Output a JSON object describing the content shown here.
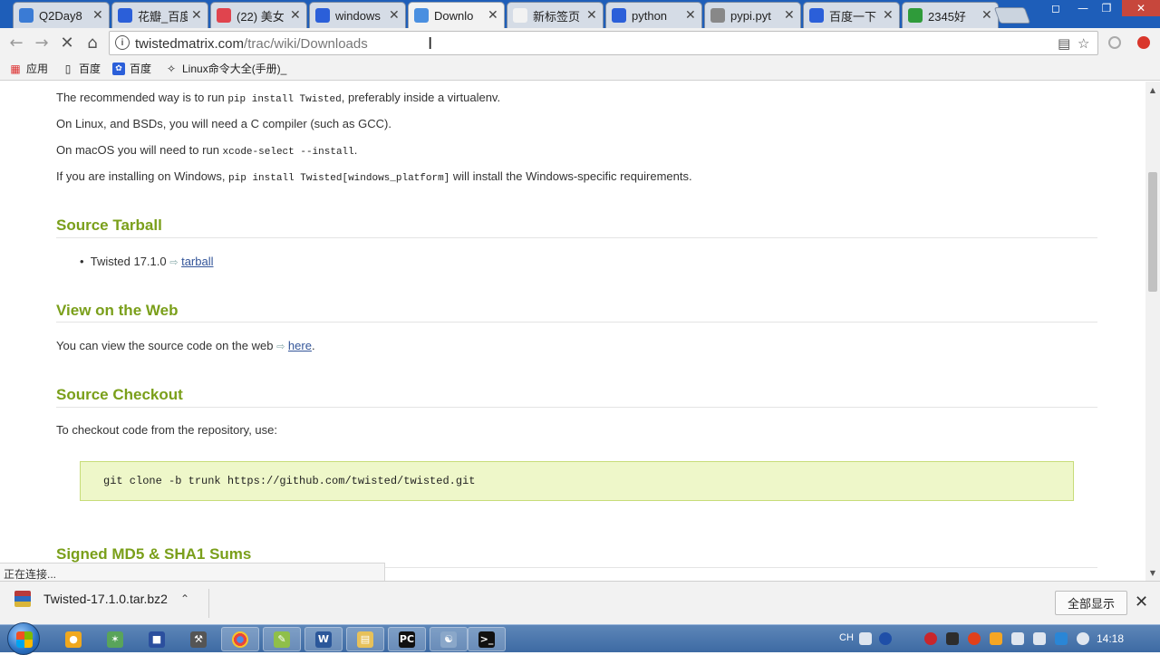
{
  "tabs": [
    {
      "title": "Q2Day8",
      "favicon_color": "#3a7bd5",
      "active": false
    },
    {
      "title": "花瓣_百度",
      "favicon_color": "#2b5fd9",
      "active": false
    },
    {
      "title": "(22) 美女",
      "favicon_color": "#e0444e",
      "active": false
    },
    {
      "title": "windows",
      "favicon_color": "#2b5fd9",
      "active": false
    },
    {
      "title": "Downlo",
      "favicon_color": "#4a8fe0",
      "active": true
    },
    {
      "title": "新标签页",
      "favicon_color": "#f2f2f2",
      "active": false
    },
    {
      "title": "python",
      "favicon_color": "#2b5fd9",
      "active": false
    },
    {
      "title": "pypi.pyt",
      "favicon_color": "#888888",
      "active": false
    },
    {
      "title": "百度一下",
      "favicon_color": "#2b5fd9",
      "active": false
    },
    {
      "title": "2345好",
      "favicon_color": "#2f9b3a",
      "active": false
    }
  ],
  "toolbar": {
    "url_host": "twistedmatrix.com",
    "url_path": "/trac/wiki/Downloads"
  },
  "bookmarks": {
    "apps": "应用",
    "items": [
      "百度",
      "百度",
      "Linux命令大全(手册)_"
    ]
  },
  "page": {
    "intro": [
      {
        "before": "The recommended way is to run ",
        "code": "pip install Twisted",
        "after": ", preferably inside a virtualenv."
      },
      {
        "before": "On Linux, and BSDs, you will need a C compiler (such as GCC).",
        "code": "",
        "after": ""
      },
      {
        "before": "On macOS you will need to run ",
        "code": "xcode-select --install",
        "after": "."
      },
      {
        "before": "If you are installing on Windows, ",
        "code": "pip install Twisted[windows_platform]",
        "after": " will install the Windows-specific requirements."
      }
    ],
    "source_tarball": {
      "heading": "Source Tarball",
      "item_text": "Twisted 17.1.0 ",
      "link": "tarball"
    },
    "view_web": {
      "heading": "View on the Web",
      "text": "You can view the source code on the web ",
      "link": "here",
      "after": "."
    },
    "checkout": {
      "heading": "Source Checkout",
      "text": "To checkout code from the repository, use:",
      "code": "git clone -b trunk https://github.com/twisted/twisted.git"
    },
    "sums_heading": "Signed MD5 & SHA1 Sums",
    "status_text": "正在连接..."
  },
  "downloads": {
    "file_name": "Twisted-17.1.0.tar.bz2",
    "show_all": "全部显示"
  },
  "taskbar": {
    "lang": "CH",
    "clock": "14:18"
  }
}
